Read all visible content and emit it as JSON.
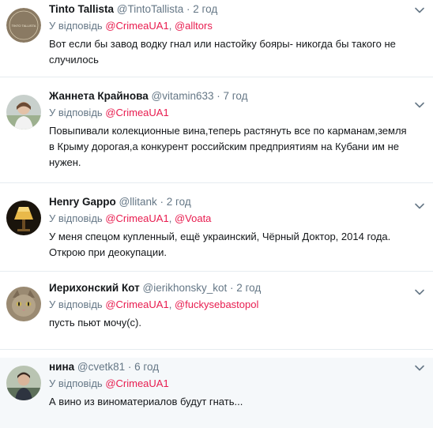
{
  "reply_prefix": "У відповідь",
  "accent_color": "#e81c4f",
  "tweets": [
    {
      "name": "Tinto Tallista",
      "handle": "@TintoTallista",
      "time": "2 год",
      "mentions": [
        "@CrimeaUA1",
        "@alltors"
      ],
      "text": "Вот если бы завод водку гнал или настойку бояры- никогда бы такого не случилось",
      "avatar_icon": "round-logo-icon",
      "avatar_logo_text": "TINTO TALLISTA"
    },
    {
      "name": "Жаннета Крайнова",
      "handle": "@vitamin633",
      "time": "7 год",
      "mentions": [
        "@CrimeaUA1"
      ],
      "text": "Повыпивали колекционные вина,теперь растянуть все по карманам,земля в Крыму дорогая,а конкурент российским предприятиям на Кубани им не нужен.",
      "avatar_icon": "person-photo-icon"
    },
    {
      "name": "Henry Gappo",
      "handle": "@llitank",
      "time": "2 год",
      "mentions": [
        "@CrimeaUA1",
        "@Voata"
      ],
      "text": "У меня спецом купленный, ещё украинский, Чёрный Доктор, 2014 года. Открою при деокупации.",
      "avatar_icon": "lamp-icon"
    },
    {
      "name": "Иерихонский Кот",
      "handle": "@ierikhonsky_kot",
      "time": "2 год",
      "mentions": [
        "@CrimeaUA1",
        "@fuckysebastopol"
      ],
      "text": "пусть пьют мочу(с).",
      "avatar_icon": "cat-icon"
    },
    {
      "name": "нина",
      "handle": "@cvetk81",
      "time": "6 год",
      "mentions": [
        "@CrimeaUA1"
      ],
      "text": "А вино из виноматериалов будут гнать...",
      "avatar_icon": "person-photo-icon"
    }
  ]
}
